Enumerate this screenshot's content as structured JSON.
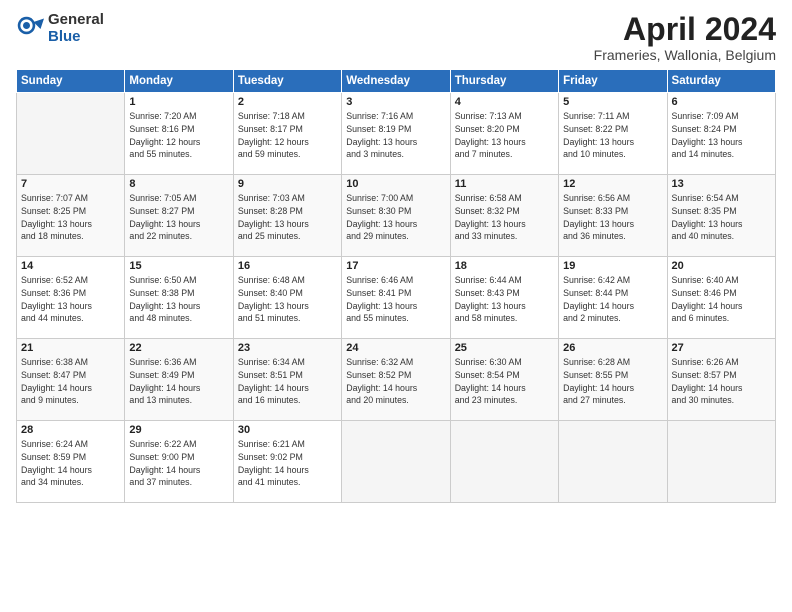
{
  "header": {
    "logo_general": "General",
    "logo_blue": "Blue",
    "month_title": "April 2024",
    "location": "Frameries, Wallonia, Belgium"
  },
  "days_of_week": [
    "Sunday",
    "Monday",
    "Tuesday",
    "Wednesday",
    "Thursday",
    "Friday",
    "Saturday"
  ],
  "weeks": [
    [
      {
        "day": "",
        "content": ""
      },
      {
        "day": "1",
        "content": "Sunrise: 7:20 AM\nSunset: 8:16 PM\nDaylight: 12 hours\nand 55 minutes."
      },
      {
        "day": "2",
        "content": "Sunrise: 7:18 AM\nSunset: 8:17 PM\nDaylight: 12 hours\nand 59 minutes."
      },
      {
        "day": "3",
        "content": "Sunrise: 7:16 AM\nSunset: 8:19 PM\nDaylight: 13 hours\nand 3 minutes."
      },
      {
        "day": "4",
        "content": "Sunrise: 7:13 AM\nSunset: 8:20 PM\nDaylight: 13 hours\nand 7 minutes."
      },
      {
        "day": "5",
        "content": "Sunrise: 7:11 AM\nSunset: 8:22 PM\nDaylight: 13 hours\nand 10 minutes."
      },
      {
        "day": "6",
        "content": "Sunrise: 7:09 AM\nSunset: 8:24 PM\nDaylight: 13 hours\nand 14 minutes."
      }
    ],
    [
      {
        "day": "7",
        "content": "Sunrise: 7:07 AM\nSunset: 8:25 PM\nDaylight: 13 hours\nand 18 minutes."
      },
      {
        "day": "8",
        "content": "Sunrise: 7:05 AM\nSunset: 8:27 PM\nDaylight: 13 hours\nand 22 minutes."
      },
      {
        "day": "9",
        "content": "Sunrise: 7:03 AM\nSunset: 8:28 PM\nDaylight: 13 hours\nand 25 minutes."
      },
      {
        "day": "10",
        "content": "Sunrise: 7:00 AM\nSunset: 8:30 PM\nDaylight: 13 hours\nand 29 minutes."
      },
      {
        "day": "11",
        "content": "Sunrise: 6:58 AM\nSunset: 8:32 PM\nDaylight: 13 hours\nand 33 minutes."
      },
      {
        "day": "12",
        "content": "Sunrise: 6:56 AM\nSunset: 8:33 PM\nDaylight: 13 hours\nand 36 minutes."
      },
      {
        "day": "13",
        "content": "Sunrise: 6:54 AM\nSunset: 8:35 PM\nDaylight: 13 hours\nand 40 minutes."
      }
    ],
    [
      {
        "day": "14",
        "content": "Sunrise: 6:52 AM\nSunset: 8:36 PM\nDaylight: 13 hours\nand 44 minutes."
      },
      {
        "day": "15",
        "content": "Sunrise: 6:50 AM\nSunset: 8:38 PM\nDaylight: 13 hours\nand 48 minutes."
      },
      {
        "day": "16",
        "content": "Sunrise: 6:48 AM\nSunset: 8:40 PM\nDaylight: 13 hours\nand 51 minutes."
      },
      {
        "day": "17",
        "content": "Sunrise: 6:46 AM\nSunset: 8:41 PM\nDaylight: 13 hours\nand 55 minutes."
      },
      {
        "day": "18",
        "content": "Sunrise: 6:44 AM\nSunset: 8:43 PM\nDaylight: 13 hours\nand 58 minutes."
      },
      {
        "day": "19",
        "content": "Sunrise: 6:42 AM\nSunset: 8:44 PM\nDaylight: 14 hours\nand 2 minutes."
      },
      {
        "day": "20",
        "content": "Sunrise: 6:40 AM\nSunset: 8:46 PM\nDaylight: 14 hours\nand 6 minutes."
      }
    ],
    [
      {
        "day": "21",
        "content": "Sunrise: 6:38 AM\nSunset: 8:47 PM\nDaylight: 14 hours\nand 9 minutes."
      },
      {
        "day": "22",
        "content": "Sunrise: 6:36 AM\nSunset: 8:49 PM\nDaylight: 14 hours\nand 13 minutes."
      },
      {
        "day": "23",
        "content": "Sunrise: 6:34 AM\nSunset: 8:51 PM\nDaylight: 14 hours\nand 16 minutes."
      },
      {
        "day": "24",
        "content": "Sunrise: 6:32 AM\nSunset: 8:52 PM\nDaylight: 14 hours\nand 20 minutes."
      },
      {
        "day": "25",
        "content": "Sunrise: 6:30 AM\nSunset: 8:54 PM\nDaylight: 14 hours\nand 23 minutes."
      },
      {
        "day": "26",
        "content": "Sunrise: 6:28 AM\nSunset: 8:55 PM\nDaylight: 14 hours\nand 27 minutes."
      },
      {
        "day": "27",
        "content": "Sunrise: 6:26 AM\nSunset: 8:57 PM\nDaylight: 14 hours\nand 30 minutes."
      }
    ],
    [
      {
        "day": "28",
        "content": "Sunrise: 6:24 AM\nSunset: 8:59 PM\nDaylight: 14 hours\nand 34 minutes."
      },
      {
        "day": "29",
        "content": "Sunrise: 6:22 AM\nSunset: 9:00 PM\nDaylight: 14 hours\nand 37 minutes."
      },
      {
        "day": "30",
        "content": "Sunrise: 6:21 AM\nSunset: 9:02 PM\nDaylight: 14 hours\nand 41 minutes."
      },
      {
        "day": "",
        "content": ""
      },
      {
        "day": "",
        "content": ""
      },
      {
        "day": "",
        "content": ""
      },
      {
        "day": "",
        "content": ""
      }
    ]
  ]
}
